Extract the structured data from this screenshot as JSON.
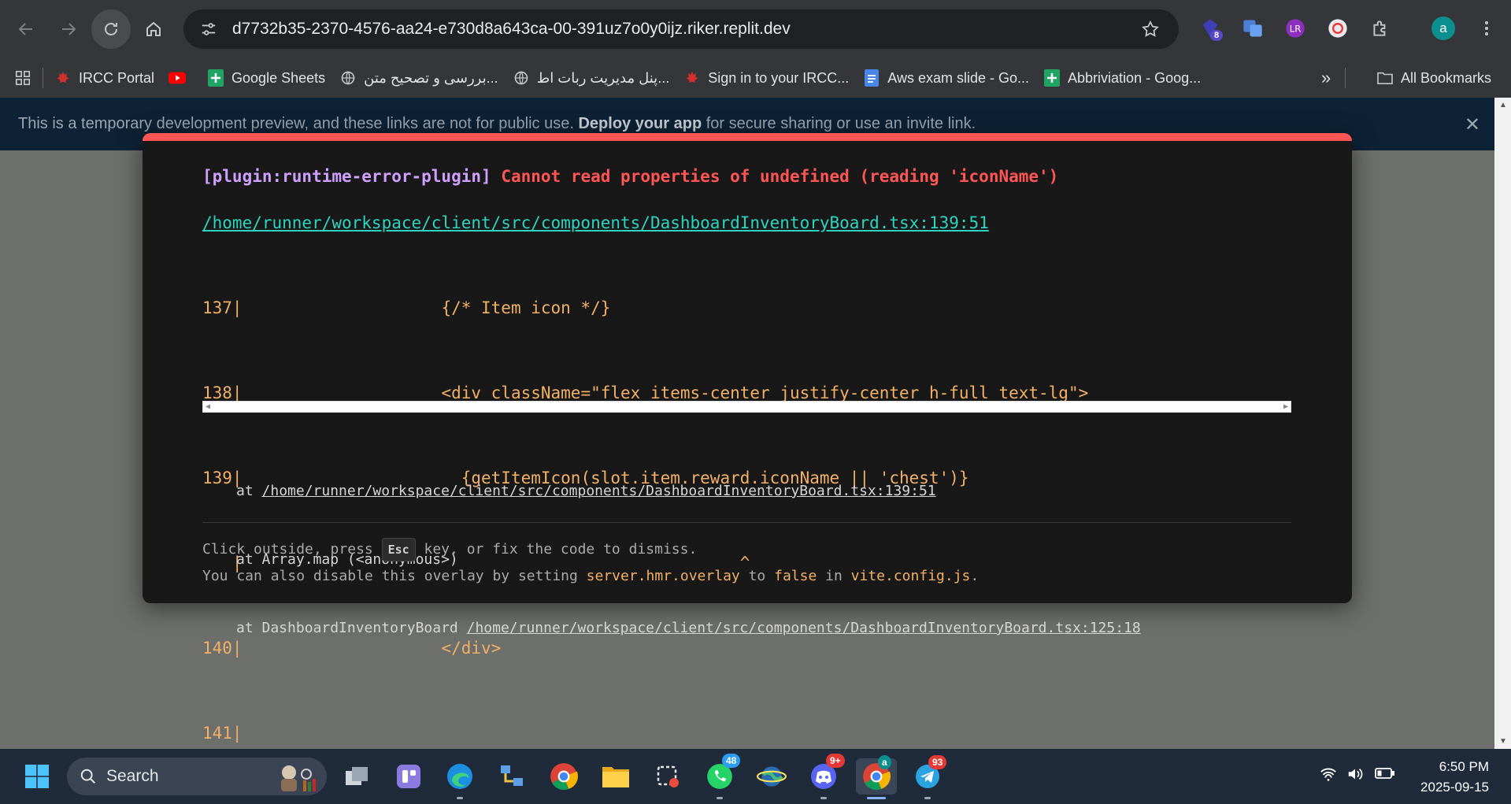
{
  "browser": {
    "url": "d7732b35-2370-4576-aa24-e730d8a643ca-00-391uz7o0y0ijz.riker.replit.dev",
    "extension_badge": "8",
    "profile_initial": "a",
    "bookmarks": [
      {
        "label": "IRCC Portal",
        "icon": "maple-leaf-icon"
      },
      {
        "label": "",
        "icon": "youtube-icon"
      },
      {
        "label": "Google Sheets",
        "icon": "sheets-icon"
      },
      {
        "label": "بررسی و تصحیح متن...",
        "icon": "globe-icon"
      },
      {
        "label": "پنل مدیریت ربات اط...",
        "icon": "globe-icon"
      },
      {
        "label": "Sign in to your IRCC...",
        "icon": "maple-leaf-icon"
      },
      {
        "label": "Aws exam slide - Go...",
        "icon": "docs-icon"
      },
      {
        "label": "Abbriviation - Goog...",
        "icon": "sheets-icon"
      }
    ],
    "more_label": "»",
    "all_bookmarks_label": "All Bookmarks"
  },
  "banner": {
    "text_before": "This is a temporary development preview, and these links are not for public use. ",
    "link": "Deploy your app",
    "text_after": " for secure sharing or use an invite link.",
    "close": "✕"
  },
  "error": {
    "plugin": "[plugin:runtime-error-plugin]",
    "message": "Cannot read properties of undefined (reading 'iconName')",
    "file": "/home/runner/workspace/client/src/components/DashboardInventoryBoard.tsx:139:51",
    "code_lines": [
      {
        "ln": "137|",
        "text": "                    {/* Item icon */}"
      },
      {
        "ln": "138|",
        "text": "                    <div className=\"flex items-center justify-center h-full text-lg\">"
      },
      {
        "ln": "139|",
        "text": "                      {getItemIcon(slot.item.reward.iconName || 'chest')}"
      },
      {
        "ln": "   |",
        "text": "                                                  ^"
      },
      {
        "ln": "140|",
        "text": "                    </div>"
      },
      {
        "ln": "141|",
        "text": ""
      }
    ],
    "stack": [
      {
        "prefix": "at ",
        "link": "/home/runner/workspace/client/src/components/DashboardInventoryBoard.tsx:139:51"
      },
      {
        "prefix": "at Array.map (<anonymous>)",
        "link": ""
      },
      {
        "prefix": "at DashboardInventoryBoard ",
        "link": "/home/runner/workspace/client/src/components/DashboardInventoryBoard.tsx:125:18"
      }
    ],
    "tip1_before": "Click outside, press ",
    "tip1_key": "Esc",
    "tip1_after": " key, or fix the code to dismiss.",
    "tip2_a": "You can also disable this overlay by setting ",
    "tip2_b": "server.hmr.overlay",
    "tip2_c": " to ",
    "tip2_d": "false",
    "tip2_e": " in ",
    "tip2_f": "vite.config.js",
    "tip2_g": "."
  },
  "taskbar": {
    "search_label": "Search",
    "whatsapp_badge": "48",
    "discord_badge": "9+",
    "telegram_badge": "93",
    "chrome_profile_badge": "a",
    "time": "6:50 PM",
    "date": "2025-09-15"
  },
  "colors": {
    "error_red": "#ff5555",
    "plugin_purple": "#cfa0ff",
    "link_teal": "#2dd4bf",
    "code_orange": "#f2b066"
  }
}
